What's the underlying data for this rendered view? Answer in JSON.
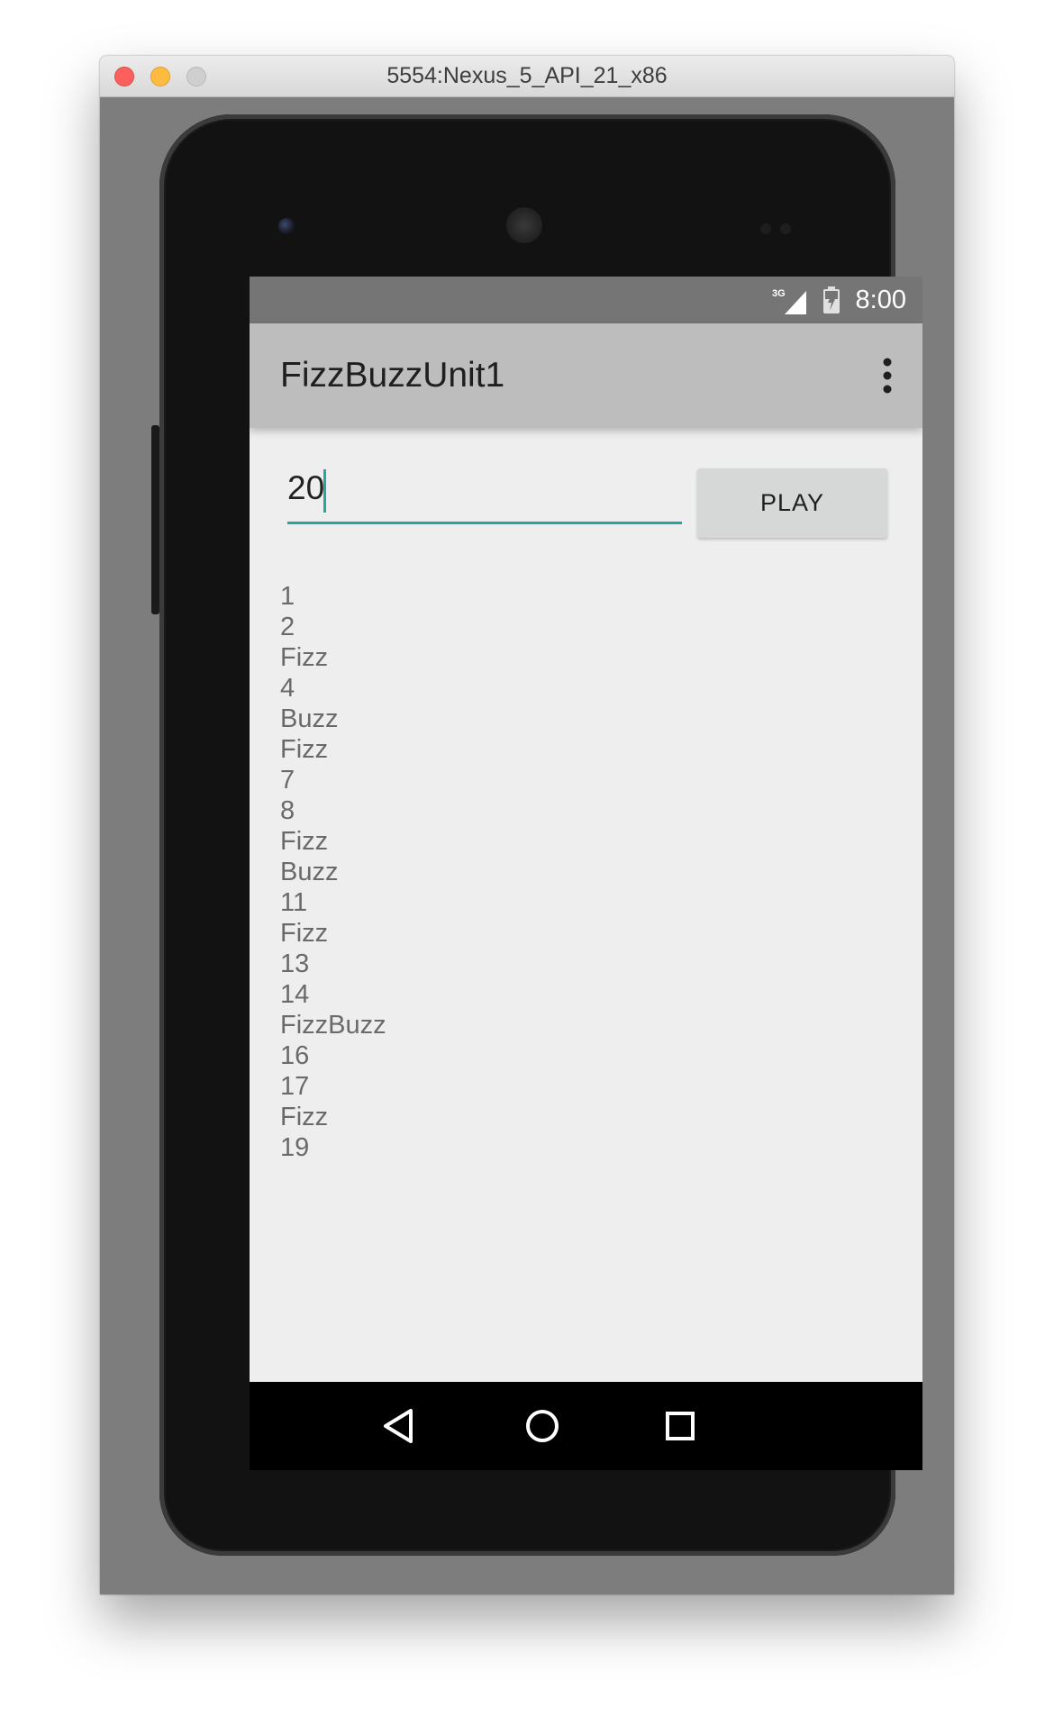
{
  "window": {
    "title": "5554:Nexus_5_API_21_x86"
  },
  "status_bar": {
    "network": "3G",
    "time": "8:00"
  },
  "app_bar": {
    "title": "FizzBuzzUnit1",
    "overflow_icon": "more-vert-icon"
  },
  "input": {
    "value": "20",
    "placeholder": ""
  },
  "play_button": {
    "label": "PLAY"
  },
  "results": [
    "1",
    "2",
    "Fizz",
    "4",
    "Buzz",
    "Fizz",
    "7",
    "8",
    "Fizz",
    "Buzz",
    "11",
    "Fizz",
    "13",
    "14",
    "FizzBuzz",
    "16",
    "17",
    "Fizz",
    "19"
  ],
  "nav_bar": {
    "back_icon": "back-triangle-icon",
    "home_icon": "home-circle-icon",
    "recents_icon": "recents-square-icon"
  },
  "colors": {
    "accent": "#26a69a",
    "app_bar": "#bdbdbd",
    "status_bar": "#757575",
    "background": "#eeeeee",
    "button": "#d6d7d7"
  }
}
